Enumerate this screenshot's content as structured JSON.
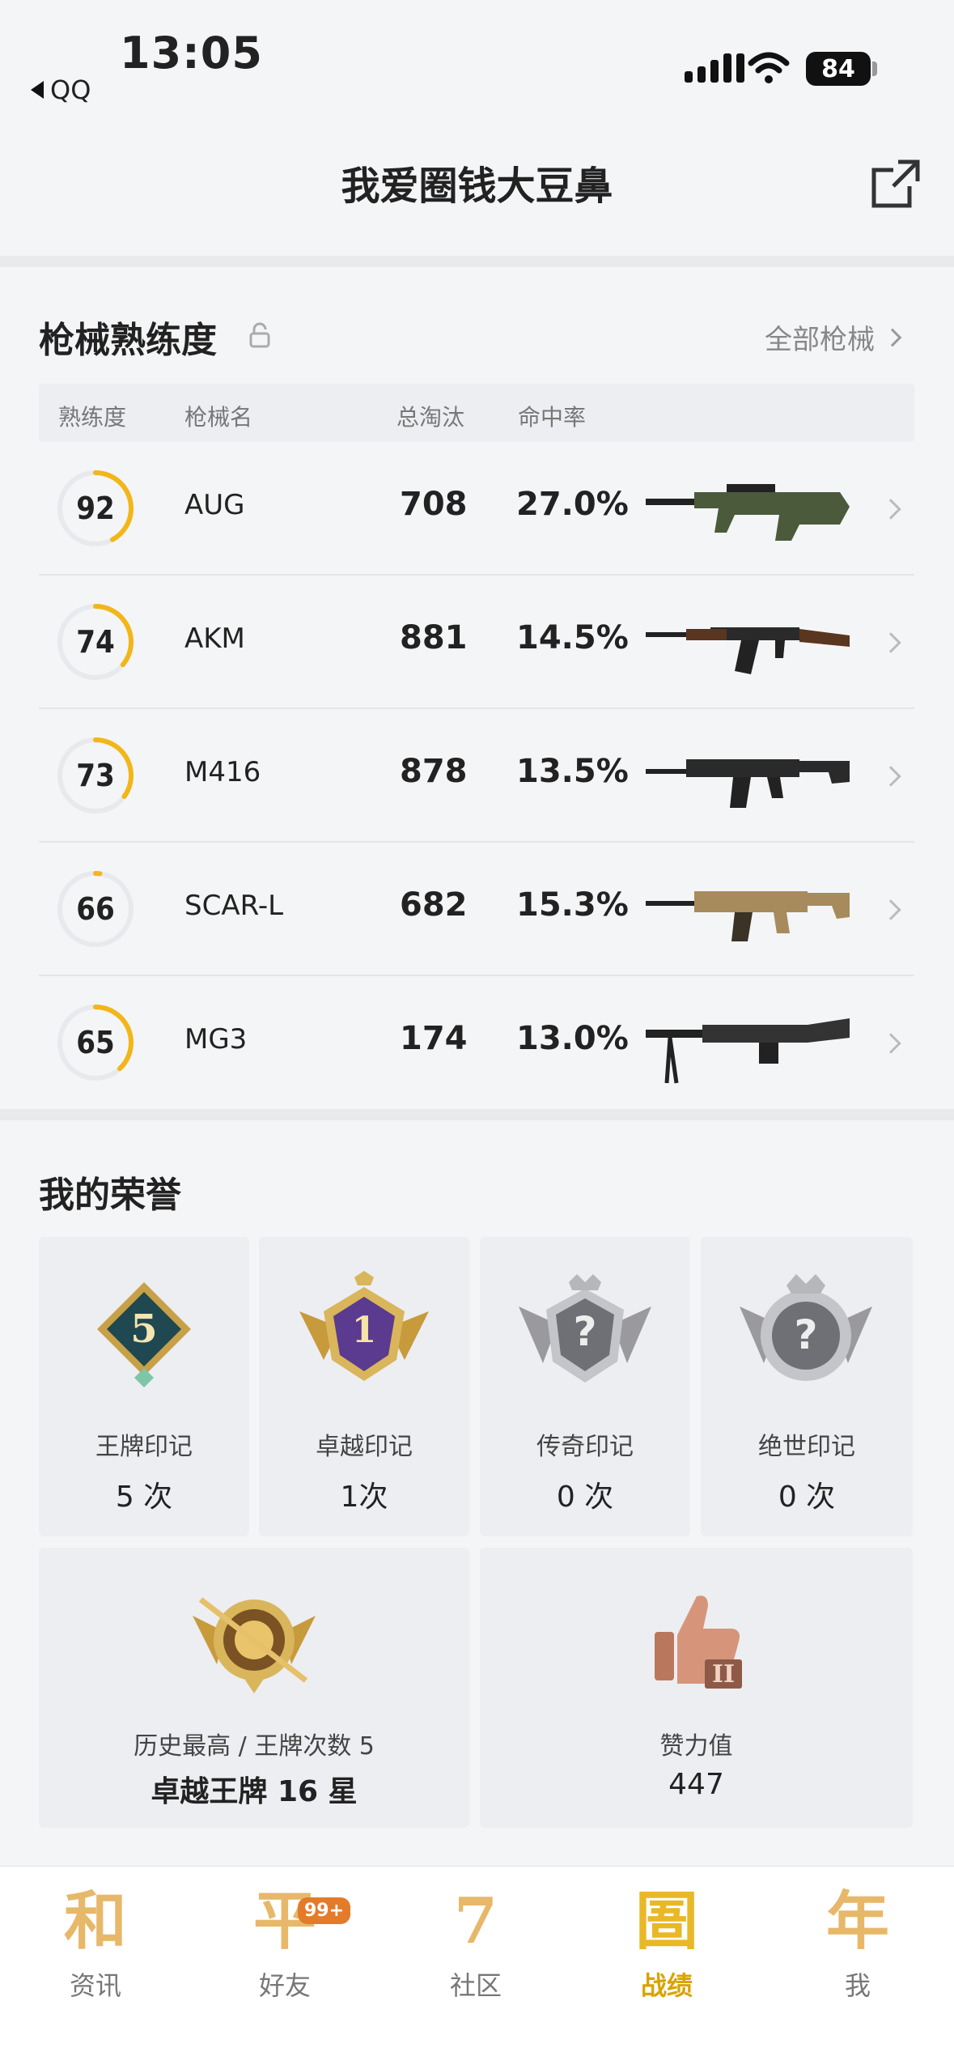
{
  "status_bar": {
    "time": "13:05",
    "back_app": "QQ",
    "battery": "84"
  },
  "header": {
    "title": "我爱圈钱大豆鼻"
  },
  "weapons": {
    "title": "枪械熟练度",
    "all_link": "全部枪械",
    "columns": [
      "熟练度",
      "枪械名",
      "总淘汰",
      "命中率"
    ],
    "rows": [
      {
        "proficiency": "92",
        "ring_fraction": 0.42,
        "name": "AUG",
        "kills": "708",
        "rate": "27.0%",
        "gun_color": "#4b5a3a"
      },
      {
        "proficiency": "74",
        "ring_fraction": 0.36,
        "name": "AKM",
        "kills": "881",
        "rate": "14.5%",
        "gun_color": "#5a3520"
      },
      {
        "proficiency": "73",
        "ring_fraction": 0.35,
        "name": "M416",
        "kills": "878",
        "rate": "13.5%",
        "gun_color": "#2a2a2a"
      },
      {
        "proficiency": "66",
        "ring_fraction": 0.02,
        "name": "SCAR-L",
        "kills": "682",
        "rate": "15.3%",
        "gun_color": "#a88b5c"
      },
      {
        "proficiency": "65",
        "ring_fraction": 0.38,
        "name": "MG3",
        "kills": "174",
        "rate": "13.0%",
        "gun_color": "#333333"
      }
    ]
  },
  "honors": {
    "title": "我的荣誉",
    "marks": [
      {
        "label": "王牌印记",
        "value": "5 次",
        "badge_text": "5"
      },
      {
        "label": "卓越印记",
        "value": "1次",
        "badge_text": "1"
      },
      {
        "label": "传奇印记",
        "value": "0 次",
        "badge_text": "?"
      },
      {
        "label": "绝世印记",
        "value": "0 次",
        "badge_text": "?"
      }
    ],
    "highest": {
      "label": "历史最高 / 王牌次数 5",
      "value": "卓越王牌 16 星"
    },
    "likes": {
      "label": "赞力值",
      "value": "447"
    }
  },
  "tabs": [
    {
      "glyph": "和",
      "label": "资讯"
    },
    {
      "glyph": "平",
      "label": "好友",
      "badge": "99+"
    },
    {
      "glyph": "7",
      "label": "社区"
    },
    {
      "glyph": "圄",
      "label": "战绩",
      "active": true
    },
    {
      "glyph": "年",
      "label": "我"
    }
  ],
  "colors": {
    "accent": "#f2b619",
    "ring_track": "#e8e9ec",
    "tab_gold": "#e7b86a"
  }
}
